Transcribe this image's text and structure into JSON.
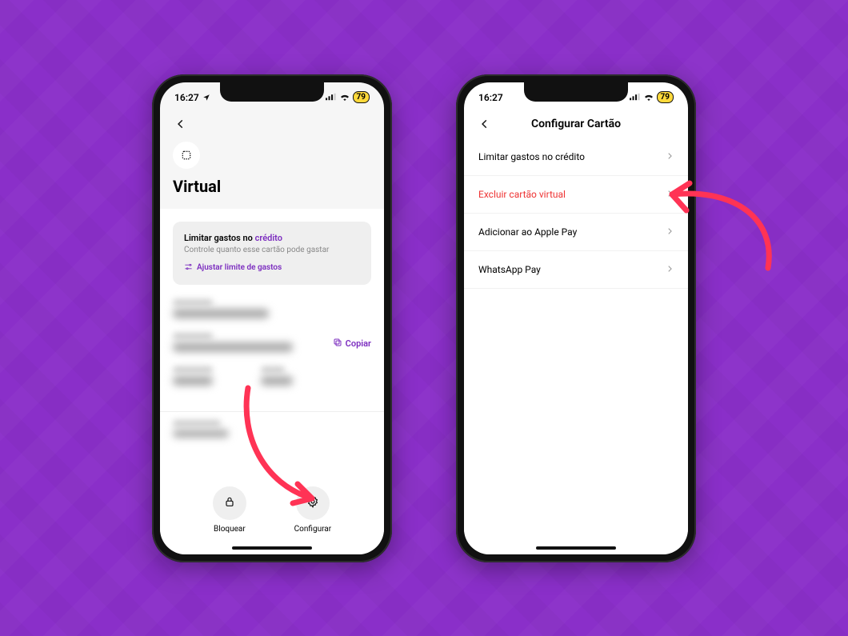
{
  "status": {
    "time": "16:27",
    "battery": "79"
  },
  "status2": {
    "time": "16:27",
    "battery": "79"
  },
  "phone1": {
    "card_type": "Virtual",
    "limit_box": {
      "line1_pre": "Limitar gastos no ",
      "line1_credit": "crédito",
      "line2": "Controle quanto esse cartão pode gastar",
      "line3": "Ajustar limite de gastos"
    },
    "copy_label": "Copiar",
    "actions": {
      "block": "Bloquear",
      "configure": "Configurar"
    }
  },
  "phone2": {
    "header": "Configurar Cartão",
    "rows": {
      "limit": "Limitar gastos no crédito",
      "delete": "Excluir cartão virtual",
      "applepay": "Adicionar ao Apple Pay",
      "whatsapp": "WhatsApp Pay"
    }
  }
}
